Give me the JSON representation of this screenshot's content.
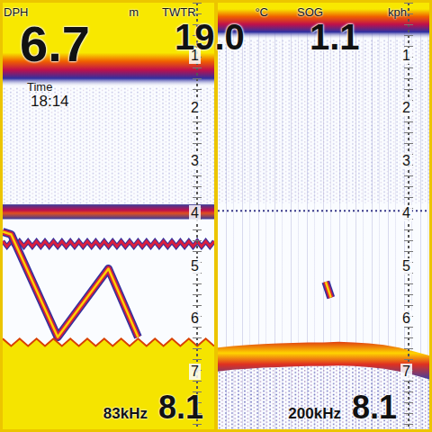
{
  "readouts": [
    {
      "label": "DPH",
      "value": "6.7",
      "unit": "m"
    },
    {
      "label": "Time",
      "value": "18:14"
    },
    {
      "label": "TWTR",
      "value": "19.0",
      "unit": "°C"
    },
    {
      "label": "SOG",
      "value": "1.1",
      "unit": "kph"
    }
  ],
  "panels": [
    {
      "frequency": "83kHz",
      "range": "8.1",
      "scale": [
        "1",
        "2",
        "3",
        "4",
        "5",
        "6",
        "7"
      ],
      "surface": {
        "solid": 0.95,
        "band": 1.6
      },
      "bottom_kind": "solid",
      "bottom": [
        6.38,
        6.52,
        6.38,
        6.52,
        6.38,
        6.52,
        6.38,
        6.52,
        6.38,
        6.52,
        6.38,
        6.52,
        6.38,
        6.52,
        6.38,
        6.52,
        6.38,
        6.52,
        6.38,
        6.52,
        6.38,
        6.52,
        6.38,
        6.52,
        6.38,
        6.52
      ],
      "layers": [
        {
          "kind": "band",
          "depth": 3.97
        },
        {
          "kind": "wave",
          "depth": 4.58
        }
      ],
      "targets": [
        {
          "points": [
            [
              0,
              4.35
            ],
            [
              4,
              4.4
            ],
            [
              26,
              6.35
            ],
            [
              50,
              5.05
            ],
            [
              64,
              6.35
            ]
          ]
        }
      ]
    },
    {
      "frequency": "200kHz",
      "range": "8.1",
      "scale": [
        "1",
        "2",
        "3",
        "4",
        "5",
        "6",
        "7"
      ],
      "surface": {
        "solid": 0.12,
        "band": 0.7
      },
      "bottom_kind": "band",
      "bottom": [
        6.55,
        6.52,
        6.5,
        6.48,
        6.47,
        6.46,
        6.45,
        6.45,
        6.44,
        6.45,
        6.47,
        6.5,
        6.55,
        6.62,
        6.7
      ],
      "layers": [
        {
          "kind": "dotted",
          "depth": 3.95
        }
      ],
      "targets": [
        {
          "points": [
            [
              51,
              5.3
            ],
            [
              53.5,
              5.6
            ]
          ]
        }
      ]
    }
  ]
}
